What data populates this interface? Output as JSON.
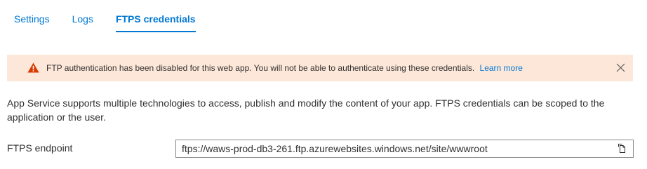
{
  "tabs": [
    {
      "label": "Settings",
      "active": false
    },
    {
      "label": "Logs",
      "active": false
    },
    {
      "label": "FTPS credentials",
      "active": true
    }
  ],
  "banner": {
    "icon": "warning-icon",
    "message": "FTP authentication has been disabled for this web app. You will not be able to authenticate using these credentials.",
    "link_label": "Learn more",
    "close_icon": "close-icon",
    "background": "#fde7d9",
    "icon_color": "#d83b01"
  },
  "description": "App Service supports multiple technologies to access, publish and modify the content of your app. FTPS credentials can be scoped to the application or the user.",
  "endpoint": {
    "label": "FTPS endpoint",
    "value": "ftps://waws-prod-db3-261.ftp.azurewebsites.windows.net/site/wwwroot",
    "copy_icon": "copy-icon"
  },
  "colors": {
    "accent": "#0078d4",
    "text": "#323130"
  }
}
